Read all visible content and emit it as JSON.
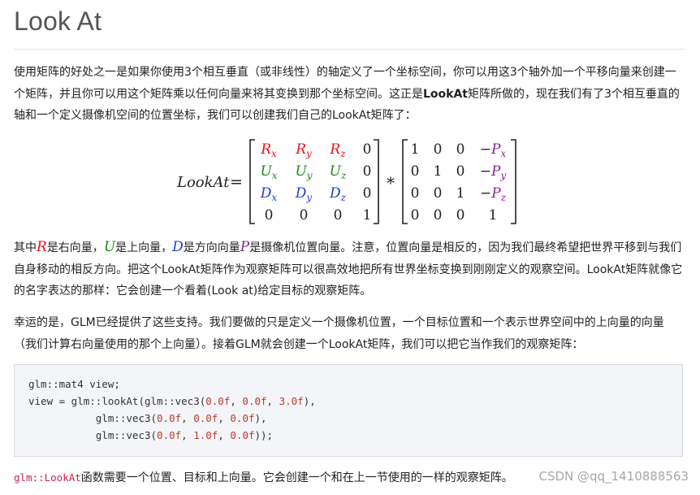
{
  "title": "Look At",
  "paragraph1": {
    "text_before_bold": "使用矩阵的好处之一是如果你使用3个相互垂直（或非线性）的轴定义了一个坐标空间，你可以用这3个轴外加一个平移向量来创建一个矩阵，并且你可以用这个矩阵乘以任何向量来将其变换到那个坐标空间。这正是",
    "bold": "LookAt",
    "text_after_bold": "矩阵所做的，现在我们有了3个相互垂直的轴和一个定义摄像机空间的位置坐标，我们可以创建我们自己的LookAt矩阵了："
  },
  "formula": {
    "lhs": "LookAt",
    "equals": "=",
    "operator": "*",
    "matrix_left": [
      [
        "R_x",
        "R_y",
        "R_z",
        "0"
      ],
      [
        "U_x",
        "U_y",
        "U_z",
        "0"
      ],
      [
        "D_x",
        "D_y",
        "D_z",
        "0"
      ],
      [
        "0",
        "0",
        "0",
        "1"
      ]
    ],
    "matrix_right": [
      [
        "1",
        "0",
        "0",
        "−P_x"
      ],
      [
        "0",
        "1",
        "0",
        "−P_y"
      ],
      [
        "0",
        "0",
        "1",
        "−P_z"
      ],
      [
        "0",
        "0",
        "0",
        "1"
      ]
    ],
    "colors": {
      "R": "#e8141b",
      "U": "#1f8a1f",
      "D": "#1e3fd0",
      "P": "#8a1f9a",
      "default": "#222222"
    }
  },
  "paragraph2": {
    "prefix": "其中",
    "r_var": "R",
    "r_desc": "是右向量，",
    "u_var": "U",
    "u_desc": "是上向量，",
    "d_var": "D",
    "d_desc": "是方向向量",
    "p_var": "P",
    "rest": "是摄像机位置向量。注意，位置向量是相反的，因为我们最终希望把世界平移到与我们自身移动的相反方向。把这个LookAt矩阵作为观察矩阵可以很高效地把所有世界坐标变换到刚刚定义的观察空间。LookAt矩阵就像它的名字表达的那样：它会创建一个看着(Look at)给定目标的观察矩阵。"
  },
  "paragraph3": "幸运的是，GLM已经提供了这些支持。我们要做的只是定义一个摄像机位置，一个目标位置和一个表示世界空间中的上向量的向量（我们计算右向量使用的那个上向量）。接着GLM就会创建一个LookAt矩阵，我们可以把它当作我们的观察矩阵：",
  "code": {
    "line1": "glm::mat4 view;",
    "line2_prefix": "view = glm::lookAt(glm::vec3(",
    "line2_args": [
      "0.0f",
      "0.0f",
      "3.0f"
    ],
    "line2_suffix": "),",
    "line3_prefix": "           glm::vec3(",
    "line3_args": [
      "0.0f",
      "0.0f",
      "0.0f"
    ],
    "line3_suffix": "),",
    "line4_prefix": "           glm::vec3(",
    "line4_args": [
      "0.0f",
      "1.0f",
      "0.0f"
    ],
    "line4_suffix": "));",
    "sep": ", "
  },
  "bottom": {
    "code": "glm::LookAt",
    "text": "函数需要一个位置、目标和上向量。它会创建一个和在上一节使用的一样的观察矩阵。"
  },
  "watermark": "CSDN @qq_1410888563"
}
